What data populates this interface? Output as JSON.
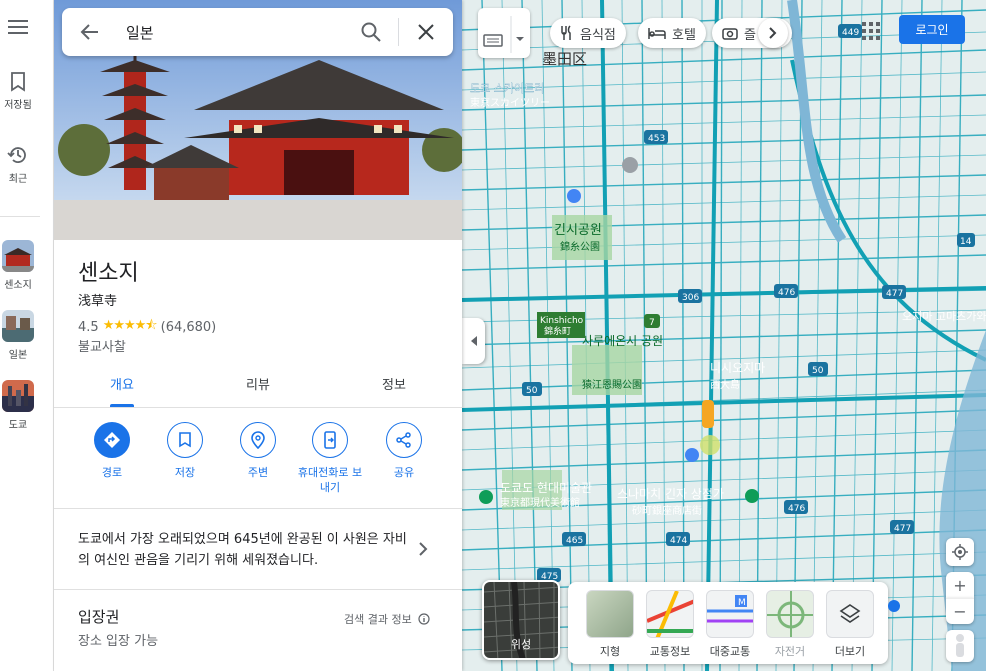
{
  "rail": {
    "saved_label": "저장됨",
    "recent_label": "최근",
    "history": [
      {
        "label": "센소지"
      },
      {
        "label": "일본"
      },
      {
        "label": "도쿄"
      }
    ]
  },
  "search": {
    "value": "일본"
  },
  "place": {
    "name": "센소지",
    "native_name": "浅草寺",
    "rating": "4.5",
    "stars": 4.5,
    "review_count": "(64,680)",
    "category": "불교사찰"
  },
  "tabs": [
    {
      "label": "개요",
      "active": true
    },
    {
      "label": "리뷰",
      "active": false
    },
    {
      "label": "정보",
      "active": false
    }
  ],
  "actions": {
    "route": "경로",
    "save": "저장",
    "nearby": "주변",
    "send_line1": "휴대전화로 보",
    "send_line2": "내기",
    "share": "공유"
  },
  "description": "도쿄에서 가장 오래되었으며 645년에 완공된 이 사원은 자비의 여신인 관음을 기리기 위해 세워졌습니다.",
  "admission": {
    "title": "입장권",
    "subtitle": "장소 입장 가능",
    "result_info": "검색 결과 정보"
  },
  "map": {
    "chips": [
      "음식점",
      "호텔",
      "즐"
    ],
    "login_label": "로그인",
    "satellite_label": "위성",
    "layers": [
      {
        "label": "지형",
        "enabled": true
      },
      {
        "label": "교통정보",
        "enabled": true
      },
      {
        "label": "대중교통",
        "enabled": true
      },
      {
        "label": "자전거",
        "enabled": false
      },
      {
        "label": "더보기",
        "enabled": true
      }
    ],
    "labels": [
      {
        "text": "墨田区"
      },
      {
        "text": "도쿄 스카이트리"
      },
      {
        "text": "東京スカイツリー"
      },
      {
        "text": "긴시공원"
      },
      {
        "text": "錦糸公園"
      },
      {
        "text": "Kinshicho"
      },
      {
        "text": "錦糸町"
      },
      {
        "text": "사루에온시 공원"
      },
      {
        "text": "猿江恩賜公園"
      },
      {
        "text": "스나마치 긴자 상점가"
      },
      {
        "text": "砂町銀座商店街"
      },
      {
        "text": "도쿄도 현대미술관"
      },
      {
        "text": "東京都現代美術館"
      },
      {
        "text": "오지마 고마츠가와 공원"
      },
      {
        "text": "니시오지마"
      },
      {
        "text": "西大島"
      }
    ],
    "route_numbers": [
      "449",
      "453",
      "306",
      "476",
      "477",
      "50",
      "7",
      "50",
      "465",
      "474",
      "476",
      "477",
      "475",
      "14"
    ]
  }
}
